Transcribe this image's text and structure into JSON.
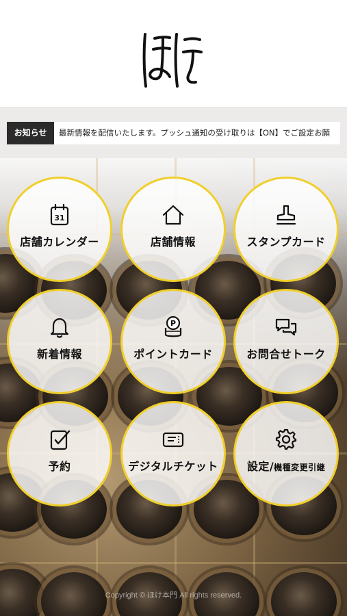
{
  "header": {
    "logo_alt": "ほけ"
  },
  "news": {
    "label": "お知らせ",
    "text": "最新情報を配信いたします。プッシュ通知の受け取りは【ON】でご設定お願"
  },
  "menu": [
    {
      "label": "店舗カレンダー",
      "icon": "calendar-icon",
      "calendar_day": "31"
    },
    {
      "label": "店舗情報",
      "icon": "home-icon"
    },
    {
      "label": "スタンプカード",
      "icon": "stamp-icon"
    },
    {
      "label": "新着情報",
      "icon": "bell-icon"
    },
    {
      "label": "ポイントカード",
      "icon": "coins-icon",
      "coin_letter": "P"
    },
    {
      "label": "お問合せトーク",
      "icon": "chat-icon"
    },
    {
      "label": "予約",
      "icon": "checklist-icon"
    },
    {
      "label": "デジタルチケット",
      "icon": "ticket-icon"
    },
    {
      "label": "設定/",
      "label_small": "機種変更引継",
      "icon": "gear-icon"
    }
  ],
  "footer": {
    "copyright": "Copyright © ほけ本門 All rights reserved."
  },
  "colors": {
    "accent": "#f0cf2b",
    "label_bg": "#2b2b2b"
  }
}
